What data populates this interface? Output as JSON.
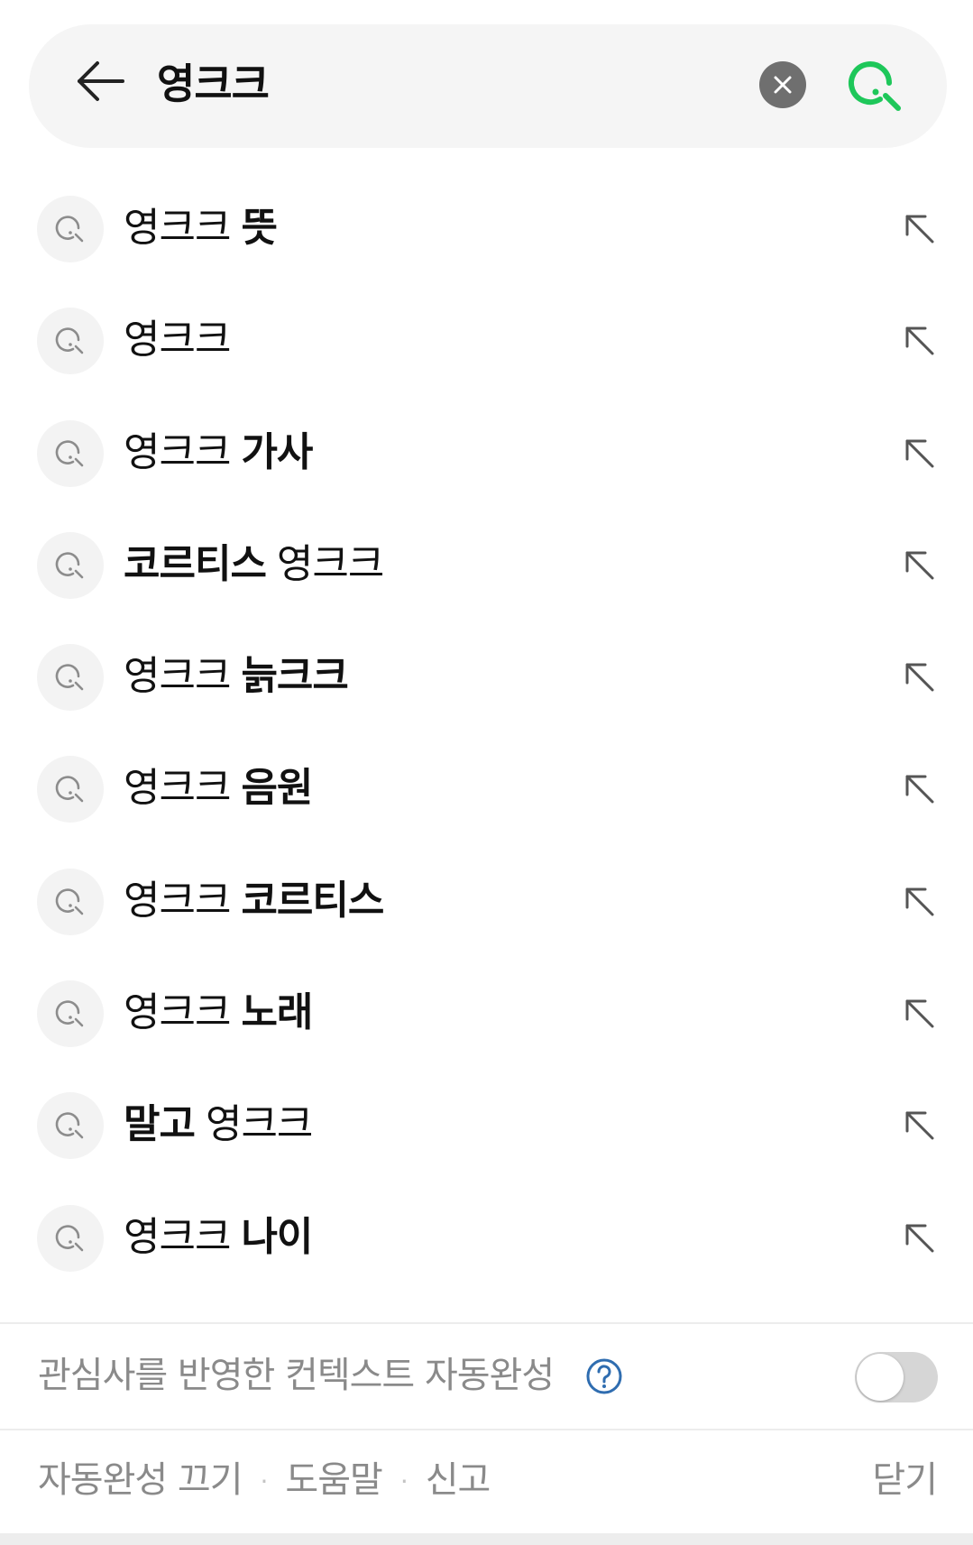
{
  "search": {
    "query": "영크크"
  },
  "suggestions": [
    {
      "pre": "영크크",
      "bold": "뜻",
      "post": ""
    },
    {
      "pre": "영크크",
      "bold": "",
      "post": ""
    },
    {
      "pre": "영크크",
      "bold": "가사",
      "post": ""
    },
    {
      "pre": "",
      "bold": "코르티스",
      "post": "영크크"
    },
    {
      "pre": "영크크",
      "bold": "늙크크",
      "post": ""
    },
    {
      "pre": "영크크",
      "bold": "음원",
      "post": ""
    },
    {
      "pre": "영크크",
      "bold": "코르티스",
      "post": ""
    },
    {
      "pre": "영크크",
      "bold": "노래",
      "post": ""
    },
    {
      "pre": "",
      "bold": "말고",
      "post": "영크크"
    },
    {
      "pre": "영크크",
      "bold": "나이",
      "post": ""
    }
  ],
  "context": {
    "label": "관심사를 반영한 컨텍스트 자동완성",
    "toggle_on": false
  },
  "footer": {
    "disable_label": "자동완성 끄기",
    "help_label": "도움말",
    "report_label": "신고",
    "close_label": "닫기",
    "separator": "·"
  },
  "colors": {
    "accent": "#1ec75a",
    "help_icon": "#2f6db0"
  }
}
